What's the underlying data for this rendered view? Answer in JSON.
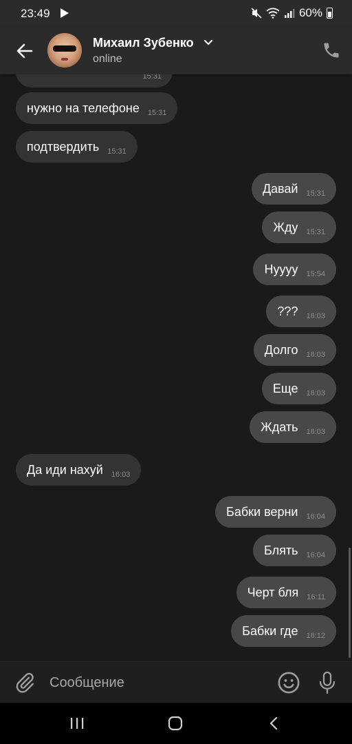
{
  "status_bar": {
    "time": "23:49",
    "battery": "60%"
  },
  "header": {
    "contact_name": "Михаил Зубенко",
    "contact_status": "online"
  },
  "messages": [
    {
      "direction": "in",
      "text": "",
      "time": "15:31"
    },
    {
      "direction": "in",
      "text": "нужно на телефоне",
      "time": "15:31"
    },
    {
      "direction": "in",
      "text": "подтвердить",
      "time": "15:31"
    },
    {
      "direction": "out",
      "text": "Давай",
      "time": "15:31"
    },
    {
      "direction": "out",
      "text": "Жду",
      "time": "15:31"
    },
    {
      "direction": "out",
      "text": "Нуууу",
      "time": "15:54"
    },
    {
      "direction": "out",
      "text": "???",
      "time": "16:03"
    },
    {
      "direction": "out",
      "text": "Долго",
      "time": "16:03"
    },
    {
      "direction": "out",
      "text": "Еще",
      "time": "16:03"
    },
    {
      "direction": "out",
      "text": "Ждать",
      "time": "16:03"
    },
    {
      "direction": "in",
      "text": "Да иди нахуй",
      "time": "16:03"
    },
    {
      "direction": "out",
      "text": "Бабки верни",
      "time": "16:04"
    },
    {
      "direction": "out",
      "text": "Блять",
      "time": "16:04"
    },
    {
      "direction": "out",
      "text": "Черт бля",
      "time": "16:11"
    },
    {
      "direction": "out",
      "text": "Бабки где",
      "time": "16:12"
    }
  ],
  "composer": {
    "placeholder": "Сообщение"
  },
  "icons": {
    "back": "arrow-left-icon",
    "call": "phone-icon",
    "attach": "paperclip-icon",
    "emoji": "smiley-icon",
    "mic": "microphone-icon"
  },
  "colors": {
    "background": "#1a1a1a",
    "header": "#2b2b2b",
    "incoming_bubble": "#333333",
    "outgoing_bubble": "#484848"
  }
}
